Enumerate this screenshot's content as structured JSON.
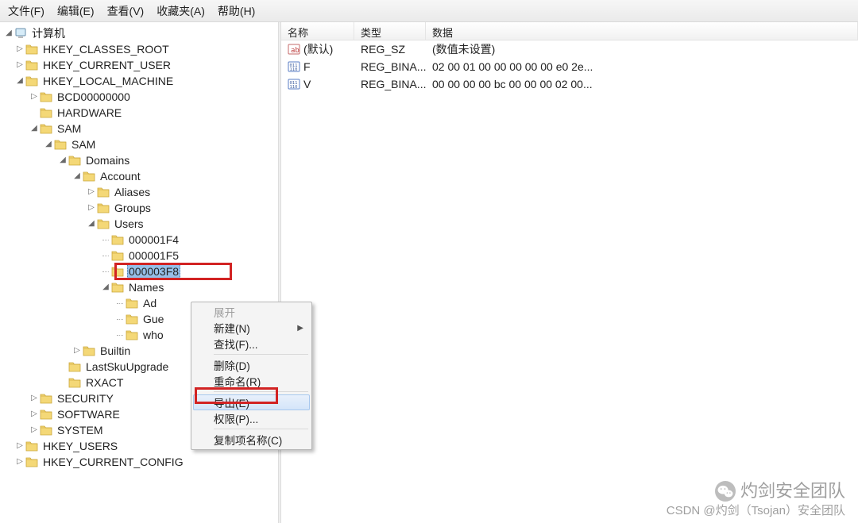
{
  "menubar": [
    {
      "label": "文件(F)"
    },
    {
      "label": "编辑(E)"
    },
    {
      "label": "查看(V)"
    },
    {
      "label": "收藏夹(A)"
    },
    {
      "label": "帮助(H)"
    }
  ],
  "tree": {
    "root": "计算机",
    "hives": [
      "HKEY_CLASSES_ROOT",
      "HKEY_CURRENT_USER",
      "HKEY_LOCAL_MACHINE",
      "HKEY_USERS",
      "HKEY_CURRENT_CONFIG"
    ],
    "hklm_children": [
      "BCD00000000",
      "HARDWARE",
      "SAM",
      "SECURITY",
      "SOFTWARE",
      "SYSTEM"
    ],
    "sam_children": [
      "SAM"
    ],
    "sam2_children": [
      "Domains",
      "LastSkuUpgrade",
      "RXACT"
    ],
    "domains_children": [
      "Account",
      "Builtin"
    ],
    "account_children": [
      "Aliases",
      "Groups",
      "Users"
    ],
    "users_children": [
      "000001F4",
      "000001F5",
      "000003F8",
      "Names"
    ],
    "names_children": [
      "Ad",
      "Gue",
      "who"
    ],
    "selected_key": "000003F8"
  },
  "list": {
    "headers": {
      "name": "名称",
      "type": "类型",
      "data": "数据"
    },
    "rows": [
      {
        "icon": "string",
        "name": "(默认)",
        "type": "REG_SZ",
        "data": "(数值未设置)"
      },
      {
        "icon": "binary",
        "name": "F",
        "type": "REG_BINA...",
        "data": "02 00 01 00 00 00 00 00 e0 2e..."
      },
      {
        "icon": "binary",
        "name": "V",
        "type": "REG_BINA...",
        "data": "00 00 00 00 bc 00 00 00 02 00..."
      }
    ]
  },
  "context_menu": {
    "items": [
      {
        "label": "展开",
        "disabled": true
      },
      {
        "label": "新建(N)",
        "submenu": true
      },
      {
        "label": "查找(F)..."
      },
      {
        "sep": true
      },
      {
        "label": "删除(D)"
      },
      {
        "label": "重命名(R)"
      },
      {
        "sep": true
      },
      {
        "label": "导出(E)",
        "hover": true,
        "highlight": true
      },
      {
        "label": "权限(P)..."
      },
      {
        "sep": true
      },
      {
        "label": "复制项名称(C)"
      }
    ]
  },
  "watermark": {
    "title": "灼剑安全团队",
    "subtitle": "CSDN @灼剑（Tsojan）安全团队"
  }
}
